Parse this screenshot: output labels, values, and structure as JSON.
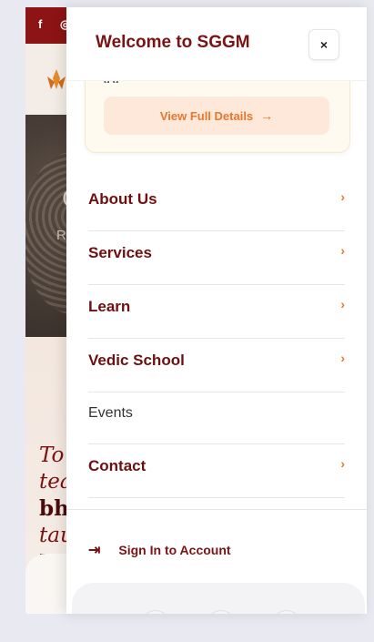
{
  "background": {
    "social_icons": [
      "f",
      "◎"
    ],
    "hero_initial": "C",
    "hero_sub": "R",
    "quote_lines": [
      "To",
      "tea",
      "bh",
      "tau",
      "M"
    ]
  },
  "drawer": {
    "title": "Welcome to SGGM",
    "close_icon": "×",
    "notice": {
      "partial_text": "g          g",
      "button_label": "View Full Details",
      "button_icon": "→"
    },
    "menu": [
      {
        "label": "About Us",
        "has_submenu": true
      },
      {
        "label": "Services",
        "has_submenu": true
      },
      {
        "label": "Learn",
        "has_submenu": true
      },
      {
        "label": "Vedic School",
        "has_submenu": true
      },
      {
        "label": "Events",
        "has_submenu": false
      },
      {
        "label": "Contact",
        "has_submenu": true
      }
    ],
    "chevron_icon": "›",
    "signin": {
      "icon": "⇥",
      "label": "Sign In to Account"
    }
  },
  "colors": {
    "brand": "#7a1313",
    "accent": "#e9772a",
    "topbar": "#8c1414"
  }
}
